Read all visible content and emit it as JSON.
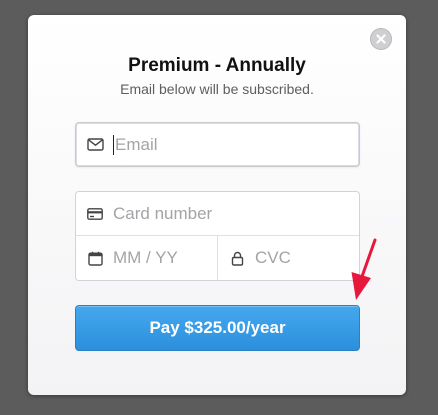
{
  "modal": {
    "title": "Premium - Annually",
    "subtitle": "Email below will be subscribed.",
    "close_icon": "close-icon"
  },
  "form": {
    "email": {
      "placeholder": "Email",
      "value": "",
      "icon": "envelope-icon"
    },
    "card_number": {
      "placeholder": "Card number",
      "value": "",
      "icon": "credit-card-icon"
    },
    "expiry": {
      "placeholder": "MM / YY",
      "value": "",
      "icon": "calendar-icon"
    },
    "cvc": {
      "placeholder": "CVC",
      "value": "",
      "icon": "lock-icon"
    }
  },
  "pay_button": {
    "label": "Pay $325.00/year"
  },
  "colors": {
    "backdrop": "#5c5c5c",
    "button": "#3a9be6",
    "annotation_arrow": "#e8183c"
  }
}
